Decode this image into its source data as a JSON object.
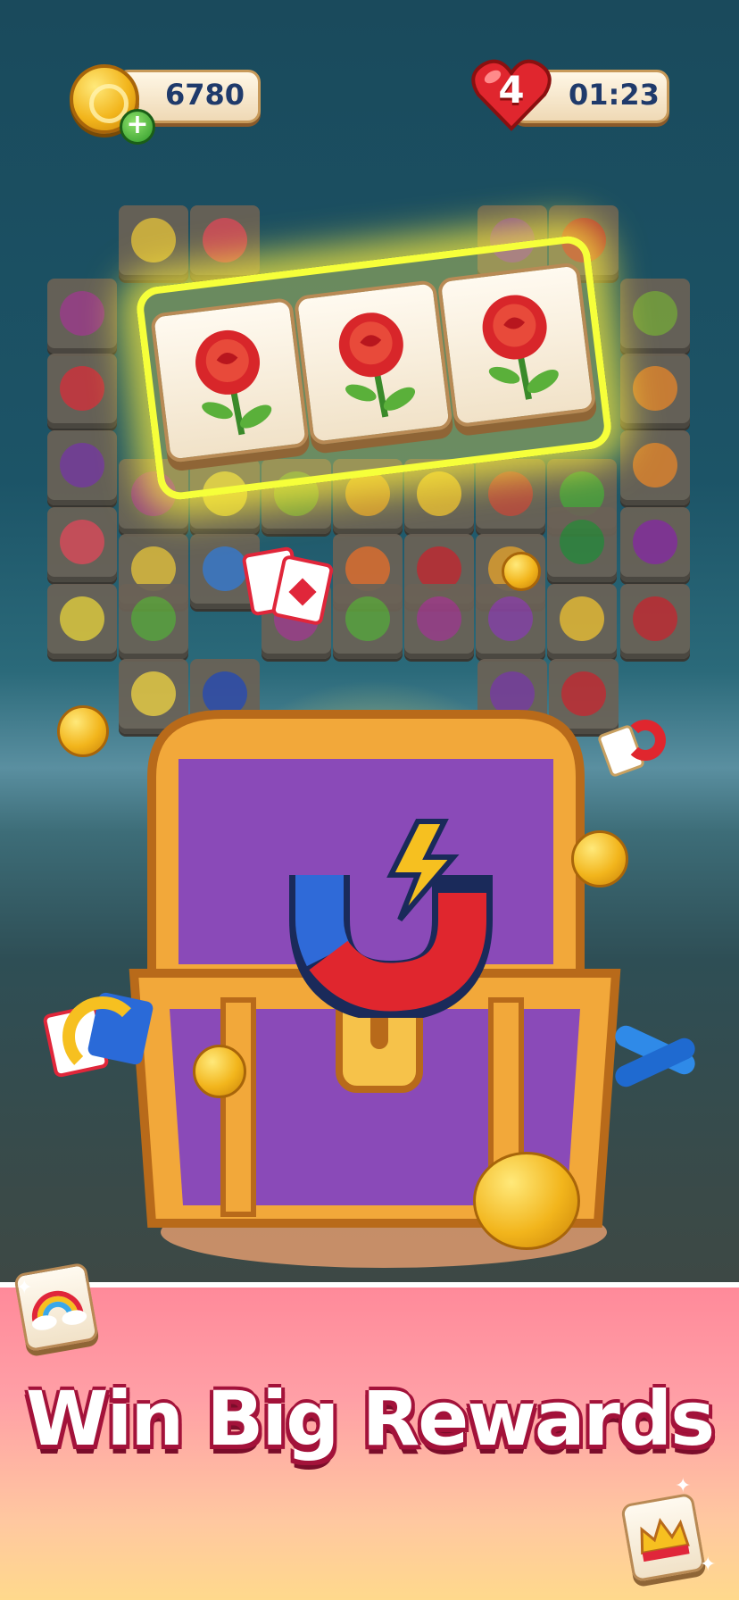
{
  "hud": {
    "coins": "6780",
    "lives": "4",
    "timer": "01:23"
  },
  "icons": {
    "coin": "coin-icon",
    "add": "plus-icon",
    "heart": "heart-icon",
    "magnet": "magnet-booster-icon",
    "shuffle": "shuffle-booster-icon",
    "undo": "undo-booster-icon",
    "swap": "swap-booster-icon",
    "chest": "treasure-chest-icon"
  },
  "board": {
    "matched_tiles": [
      "rose",
      "rose",
      "rose"
    ]
  },
  "banner": {
    "title": "Win Big Rewards"
  },
  "colors": {
    "accent_pink": "#ff8a9a",
    "title_outline": "#a3123a",
    "highlight": "#f6ff3a"
  }
}
